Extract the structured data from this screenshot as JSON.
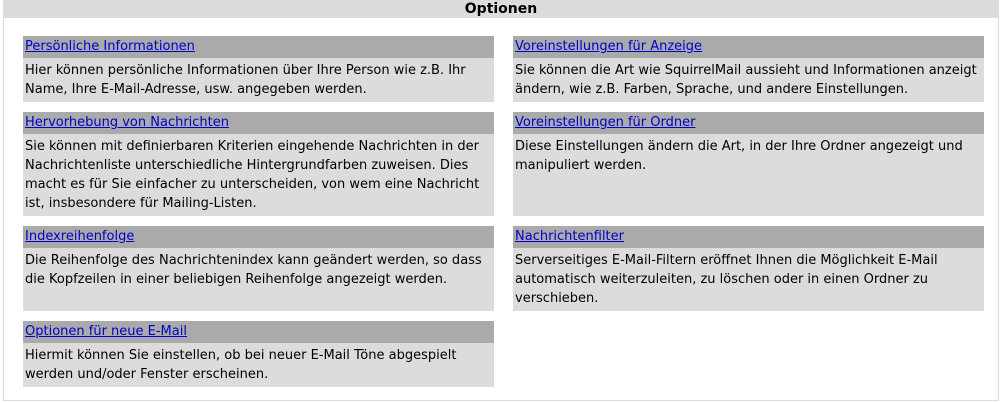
{
  "header": {
    "title": "Optionen"
  },
  "left": [
    {
      "link": "Persönliche Informationen",
      "desc": "Hier können persönliche Informationen über Ihre Person wie z.B. Ihr Name, Ihre E-Mail-Adresse, usw. angegeben werden."
    },
    {
      "link": "Hervorhebung von Nachrichten",
      "desc": "Sie können mit definierbaren Kriterien eingehende Nachrichten in der Nachrichtenliste unterschiedliche Hintergrundfarben zuweisen. Dies macht es für Sie einfacher zu unterscheiden, von wem eine Nachricht ist, insbesondere für Mailing-Listen."
    },
    {
      "link": "Indexreihenfolge",
      "desc": "Die Reihenfolge des Nachrichtenindex kann geändert werden, so dass die Kopfzeilen in einer beliebigen Reihenfolge angezeigt werden."
    },
    {
      "link": "Optionen für neue E-Mail",
      "desc": "Hiermit können Sie einstellen, ob bei neuer E-Mail Töne abgespielt werden und/oder Fenster erscheinen."
    }
  ],
  "right": [
    {
      "link": "Voreinstellungen für Anzeige",
      "desc": "Sie können die Art wie SquirrelMail aussieht und Informationen anzeigt ändern, wie z.B. Farben, Sprache, und andere Einstellungen."
    },
    {
      "link": "Voreinstellungen für Ordner",
      "desc": "Diese Einstellungen ändern die Art, in der Ihre Ordner angezeigt und manipuliert werden."
    },
    {
      "link": "Nachrichtenfilter",
      "desc": "Serverseitiges E-Mail-Filtern eröffnet Ihnen die Möglichkeit E-Mail automatisch weiterzuleiten, zu löschen oder in einen Ordner zu verschieben."
    }
  ]
}
